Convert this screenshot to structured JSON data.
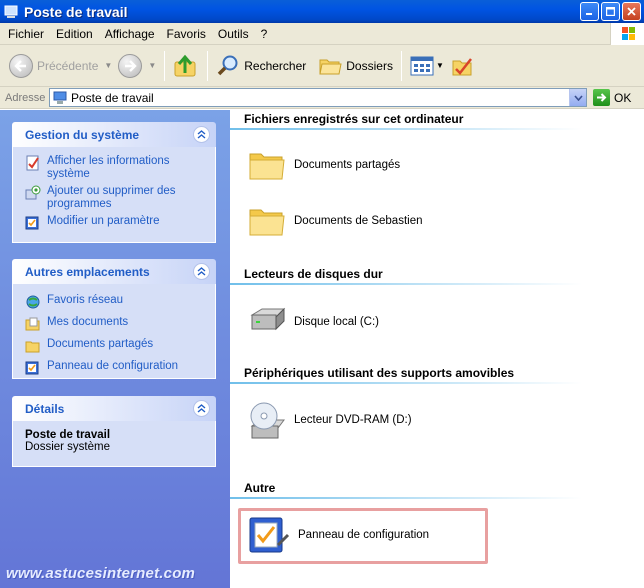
{
  "window": {
    "title": "Poste de travail"
  },
  "menu": [
    "Fichier",
    "Edition",
    "Affichage",
    "Favoris",
    "Outils",
    "?"
  ],
  "toolbar": {
    "back_label": "Précédente",
    "search_label": "Rechercher",
    "folders_label": "Dossiers"
  },
  "address": {
    "label": "Adresse",
    "value": "Poste de travail",
    "go_label": "OK"
  },
  "left": {
    "system": {
      "title": "Gestion du système",
      "items": [
        {
          "label": "Afficher les informations système",
          "icon": "system-info-icon"
        },
        {
          "label": "Ajouter ou supprimer des programmes",
          "icon": "add-remove-programs-icon"
        },
        {
          "label": "Modifier un paramètre",
          "icon": "control-panel-icon"
        }
      ]
    },
    "places": {
      "title": "Autres emplacements",
      "items": [
        {
          "label": "Favoris réseau",
          "icon": "network-icon"
        },
        {
          "label": "Mes documents",
          "icon": "documents-icon"
        },
        {
          "label": "Documents partagés",
          "icon": "shared-folder-icon"
        },
        {
          "label": "Panneau de configuration",
          "icon": "control-panel-icon"
        }
      ]
    },
    "details": {
      "title": "Détails",
      "name": "Poste de travail",
      "type": "Dossier système"
    }
  },
  "content": {
    "groups": [
      {
        "title": "Fichiers enregistrés sur cet ordinateur",
        "items": [
          {
            "label": "Documents partagés"
          },
          {
            "label": "Documents de Sebastien"
          }
        ]
      },
      {
        "title": "Lecteurs de disques dur",
        "items": [
          {
            "label": "Disque local (C:)"
          }
        ]
      },
      {
        "title": "Périphériques utilisant des supports amovibles",
        "items": [
          {
            "label": "Lecteur DVD-RAM (D:)"
          }
        ]
      },
      {
        "title": "Autre",
        "items": [
          {
            "label": "Panneau de configuration"
          }
        ]
      }
    ]
  },
  "watermark": "www.astucesinternet.com",
  "colors": {
    "title_bar": "#0054e3",
    "task_pane": "#7ba2e7",
    "link": "#215dc6",
    "highlight": "#e8a0a0"
  }
}
